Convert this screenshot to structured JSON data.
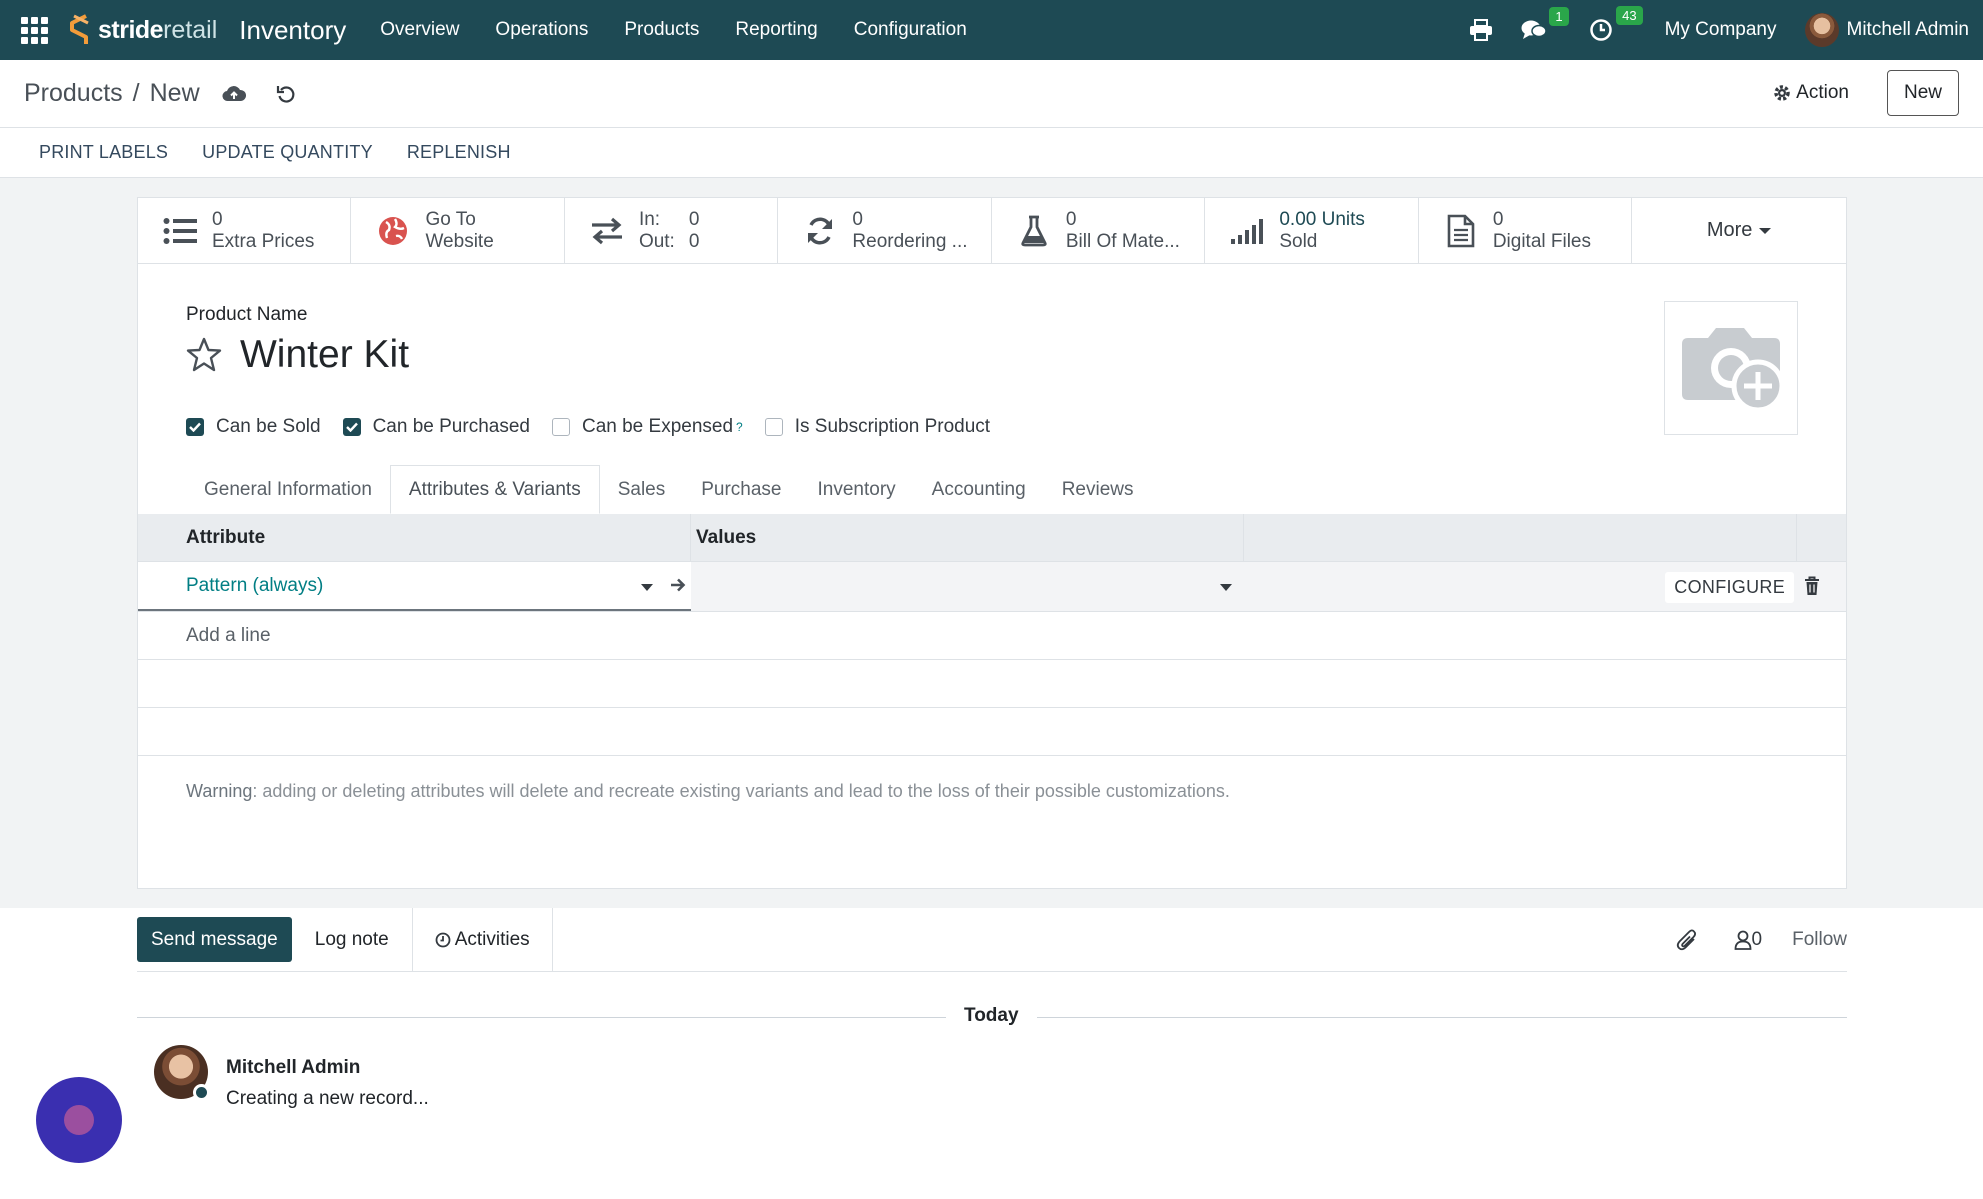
{
  "navbar": {
    "brand_bold": "stride",
    "brand_light": "retail",
    "app_name": "Inventory",
    "menu": [
      "Overview",
      "Operations",
      "Products",
      "Reporting",
      "Configuration"
    ],
    "messages_count": "1",
    "activities_count": "43",
    "company": "My Company",
    "user": "Mitchell Admin"
  },
  "control": {
    "breadcrumb_parent": "Products",
    "breadcrumb_sep": "/",
    "breadcrumb_current": "New",
    "action_label": "Action",
    "new_label": "New"
  },
  "header_buttons": [
    "PRINT LABELS",
    "UPDATE QUANTITY",
    "REPLENISH"
  ],
  "smart_buttons": {
    "extra_prices": {
      "value": "0",
      "label": "Extra Prices"
    },
    "website": {
      "line1": "Go To",
      "line2": "Website"
    },
    "inout": {
      "in_label": "In:",
      "in_value": "0",
      "out_label": "Out:",
      "out_value": "0"
    },
    "reordering": {
      "value": "0",
      "label": "Reordering ..."
    },
    "bom": {
      "value": "0",
      "label": "Bill Of Mate..."
    },
    "sold": {
      "value": "0.00 Units",
      "label": "Sold"
    },
    "files": {
      "value": "0",
      "label": "Digital Files"
    },
    "more": "More"
  },
  "form": {
    "product_name_label": "Product Name",
    "product_name": "Winter Kit",
    "checkboxes": [
      {
        "label": "Can be Sold",
        "checked": true
      },
      {
        "label": "Can be Purchased",
        "checked": true
      },
      {
        "label": "Can be Expensed",
        "checked": false
      },
      {
        "label": "Is Subscription Product",
        "checked": false
      }
    ],
    "help_mark": "?",
    "tabs": [
      "General Information",
      "Attributes & Variants",
      "Sales",
      "Purchase",
      "Inventory",
      "Accounting",
      "Reviews"
    ],
    "active_tab": "Attributes & Variants"
  },
  "attributes_table": {
    "col_attribute": "Attribute",
    "col_values": "Values",
    "rows": [
      {
        "attribute": "Pattern (always)",
        "values": ""
      }
    ],
    "configure_label": "CONFIGURE",
    "add_line": "Add a line",
    "warning_label": "Warning",
    "warning_text": ": adding or deleting attributes will delete and recreate existing variants and lead to the loss of their possible customizations."
  },
  "chatter": {
    "send_message": "Send message",
    "log_note": "Log note",
    "activities": "Activities",
    "followers_count": "0",
    "follow": "Follow",
    "date_separator": "Today",
    "messages": [
      {
        "author": "Mitchell Admin",
        "body": "Creating a new record..."
      }
    ]
  },
  "colors": {
    "navbar": "#1e4a54",
    "accent": "#017e84",
    "badge": "#2aa64a",
    "primary_button": "#1e4a54"
  }
}
